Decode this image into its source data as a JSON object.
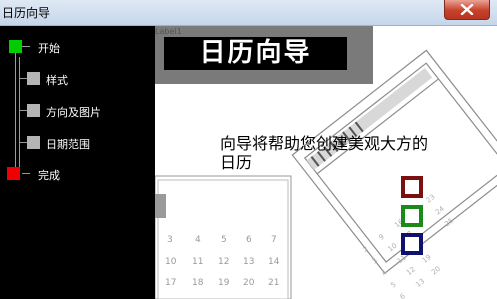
{
  "window": {
    "title": "日历向导"
  },
  "steps": [
    {
      "label": "开始",
      "state": "current",
      "color": "#00cc00"
    },
    {
      "label": "样式",
      "state": "pending",
      "color": "#b4b4b4"
    },
    {
      "label": "方向及图片",
      "state": "pending",
      "color": "#b4b4b4"
    },
    {
      "label": "日期范围",
      "state": "pending",
      "color": "#b4b4b4"
    },
    {
      "label": "完成",
      "state": "final",
      "color": "#ee0000"
    }
  ],
  "header": {
    "control_label": "Label1",
    "title": "日历向导"
  },
  "main": {
    "description_line1": "向导将帮助您创建美观大方的",
    "description_line2": "日历"
  },
  "style_swatches": [
    {
      "name": "dark-red",
      "color": "#7a1010"
    },
    {
      "name": "green",
      "color": "#1a8a1a"
    },
    {
      "name": "navy",
      "color": "#101070"
    }
  ],
  "calendar_numbers": [
    [
      "3",
      "4",
      "5",
      "6",
      "7"
    ],
    [
      "10",
      "11",
      "12",
      "13",
      "14"
    ],
    [
      "17",
      "18",
      "19",
      "20",
      "21"
    ]
  ]
}
